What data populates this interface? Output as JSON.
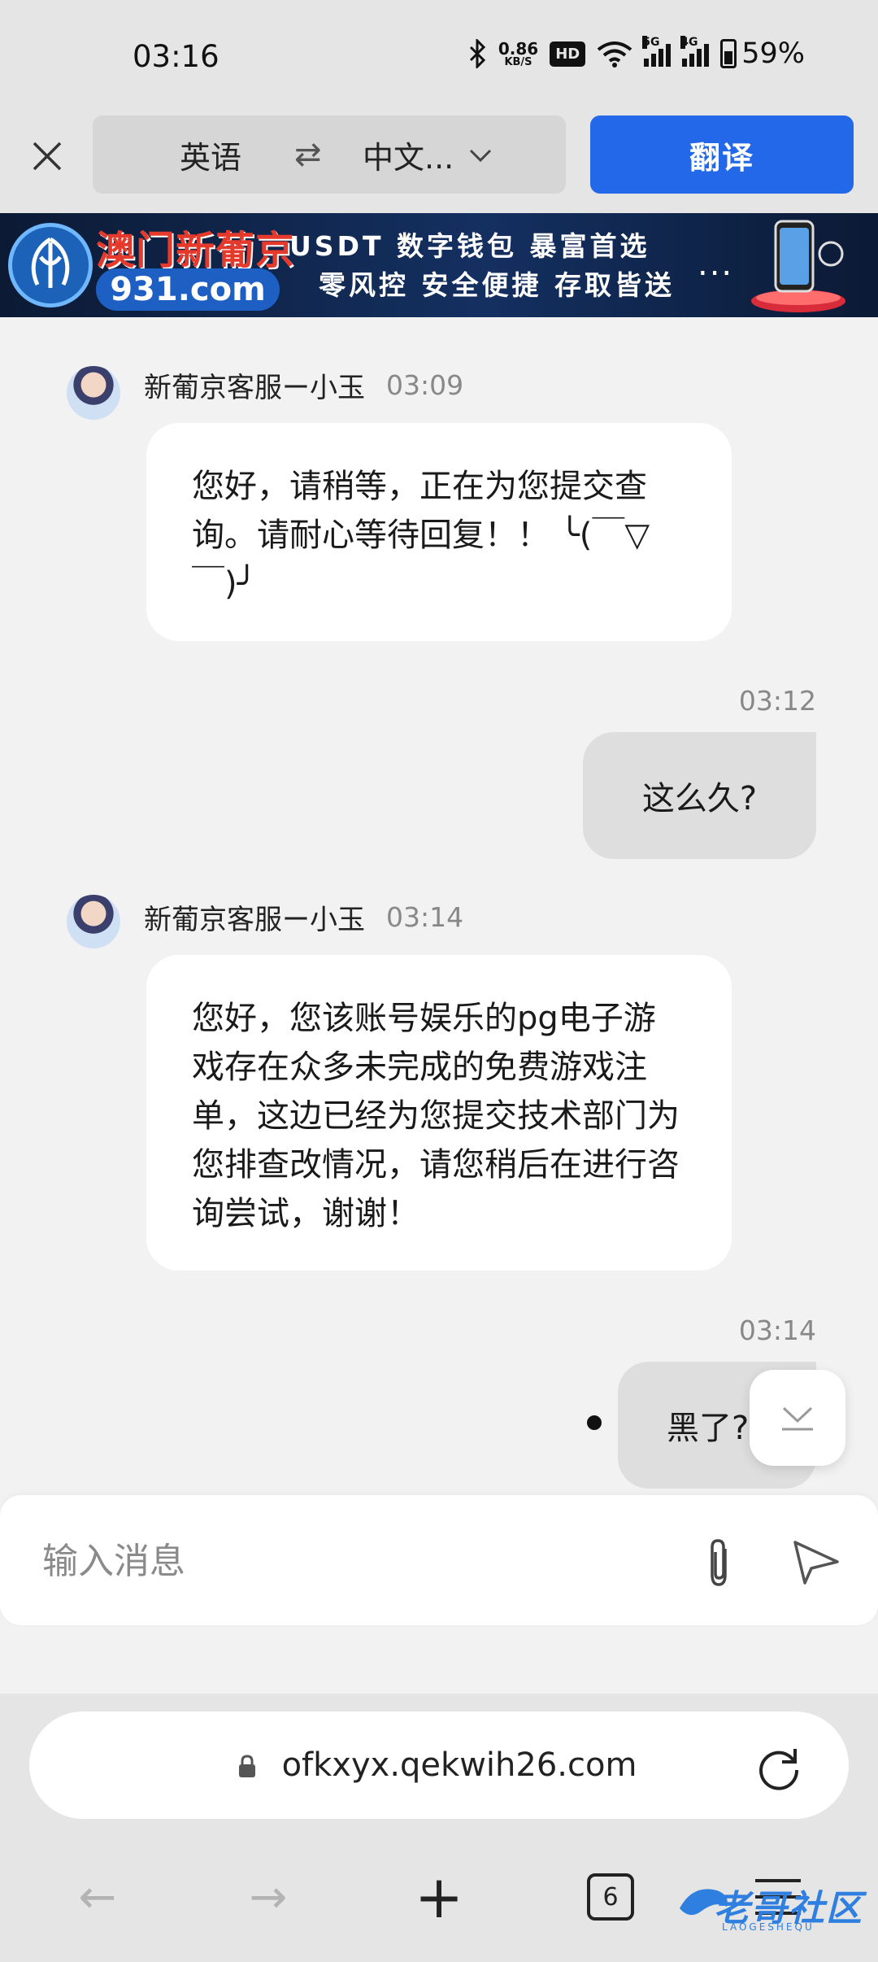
{
  "status_bar": {
    "time": "03:16",
    "net_speed_value": "0.86",
    "net_speed_unit": "KB/S",
    "hd_label": "HD",
    "sim1_label": "5G",
    "sim2_label": "4G",
    "battery": "59%"
  },
  "translate_bar": {
    "source_lang": "英语",
    "swap_symbol": "⇄",
    "target_lang": "中文...",
    "translate_button": "翻译"
  },
  "banner": {
    "brand": "澳门新葡京",
    "domain": "931.com",
    "line1": "USDT 数字钱包 暴富首选",
    "line2": "零风控 安全便捷 存取皆送",
    "more": "..."
  },
  "chat": {
    "messages": [
      {
        "sender": "新葡京客服ー小玉",
        "time": "03:09",
        "text": "您好，请稍等，正在为您提交查询。请耐心等待回复！！ ╰(￣▽￣)╯"
      },
      {
        "time": "03:12",
        "text": "这么久?"
      },
      {
        "sender": "新葡京客服ー小玉",
        "time": "03:14",
        "text": "您好，您该账号娱乐的pg电子游戏存在众多未完成的免费游戏注单，这边已经为您提交技术部门为您排查改情况，请您稍后在进行咨询尝试，谢谢！"
      },
      {
        "time": "03:14",
        "text": "黑了?"
      }
    ]
  },
  "composer": {
    "placeholder": "输入消息"
  },
  "browser": {
    "url": "ofkxyx.qekwih26.com",
    "tab_count": "6"
  },
  "watermark": {
    "text": "老哥社区",
    "sub": "LAOGESHEQU"
  },
  "colors": {
    "accent": "#2268e8",
    "incoming_bubble": "#ffffff",
    "outgoing_bubble": "#dedede",
    "background": "#f2f2f2"
  }
}
